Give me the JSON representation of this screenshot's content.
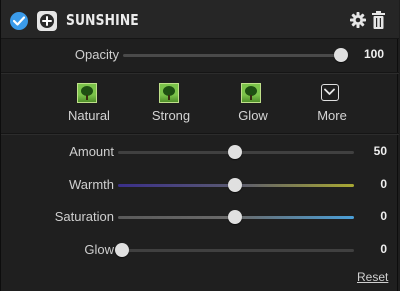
{
  "header": {
    "title": "SUNSHINE",
    "enabled": true,
    "icons": [
      "checkmark-icon",
      "plus-icon",
      "gear-icon",
      "trash-icon"
    ]
  },
  "opacity": {
    "label": "Opacity",
    "value": "100",
    "level": 100
  },
  "presets": [
    {
      "label": "Natural",
      "icon": "tree-thumbnail-icon"
    },
    {
      "label": "Strong",
      "icon": "tree-thumbnail-icon"
    },
    {
      "label": "Glow",
      "icon": "tree-thumbnail-icon"
    },
    {
      "label": "More",
      "icon": "chevron-down-icon"
    }
  ],
  "sliders": [
    {
      "label": "Amount",
      "value": "50",
      "level": 50
    },
    {
      "label": "Warmth",
      "value": "0",
      "level": 50
    },
    {
      "label": "Saturation",
      "value": "0",
      "level": 50
    },
    {
      "label": "Glow",
      "value": "0",
      "level": 0
    }
  ],
  "footer": {
    "reset_label": "Reset"
  },
  "colors": {
    "accent": "#3b9bea",
    "warmth_start": "#3a2f8a",
    "warmth_end": "#a8a832",
    "saturation_start": "#5a5a5a",
    "saturation_end": "#4a9fd8"
  }
}
